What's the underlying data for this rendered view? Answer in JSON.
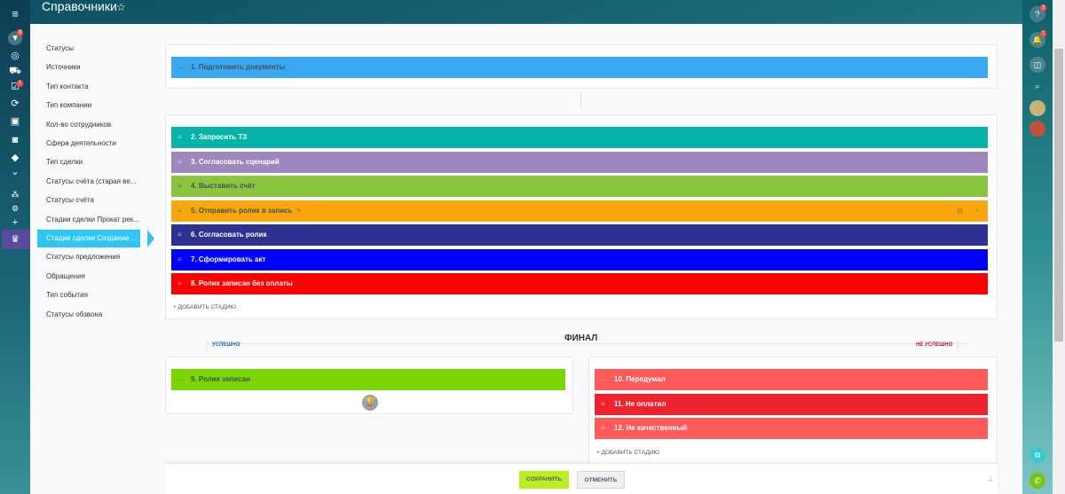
{
  "header": {
    "title": "Справочники"
  },
  "left_nav": [
    {
      "icon": "menu-icon"
    },
    {
      "icon": "filter-icon",
      "badge": "9"
    },
    {
      "icon": "target-icon"
    },
    {
      "icon": "cart-icon"
    },
    {
      "icon": "tasks-icon",
      "badge": "1"
    },
    {
      "icon": "share-icon"
    },
    {
      "icon": "contact-card-icon"
    },
    {
      "icon": "robot-icon"
    },
    {
      "icon": "box-icon"
    },
    {
      "icon": "chevron-down-circle-icon"
    },
    {
      "icon": "sitemap-icon"
    },
    {
      "icon": "gear-icon"
    },
    {
      "icon": "plus-icon"
    },
    {
      "icon": "crown-icon"
    }
  ],
  "menu": [
    "Статусы",
    "Источники",
    "Тип контакта",
    "Тип компании",
    "Кол-во сотрудников",
    "Сфера деятельности",
    "Тип сделки",
    "Статусы счёта (старая ве...",
    "Статусы счёта",
    "Стадии сделки Прокат рек...",
    "Стадии сделки Создание ...",
    "Статусы предложения",
    "Обращения",
    "Тип события",
    "Статусы обзвона"
  ],
  "active_menu_index": 10,
  "first_stage": {
    "label": "1. Подготовить документы",
    "color": "#39a8ef"
  },
  "stages": [
    {
      "label": "2. Запросить ТЗ",
      "color": "#07b2a8",
      "text": "#fff"
    },
    {
      "label": "3. Согласовать сценарий",
      "color": "#9d87bd",
      "text": "#fff"
    },
    {
      "label": "4. Выставить счёт",
      "color": "#8bc43f",
      "text": "#44525e"
    },
    {
      "label": "5. Отправить ролик в запись",
      "color": "#f9a70c",
      "text": "#44525e"
    },
    {
      "label": "6. Согласовать ролик",
      "color": "#2e3192",
      "text": "#fff"
    },
    {
      "label": "7. Сформировать акт",
      "color": "#0000ff",
      "text": "#fff"
    },
    {
      "label": "8. Ролик записан без оплаты",
      "color": "#ff0000",
      "text": "#fff"
    }
  ],
  "add_stage": "+ ДОБАВИТЬ СТАДИЮ",
  "final": {
    "title": "ФИНАЛ",
    "success_label": "УСПЕШНО",
    "fail_label": "НЕ УСПЕШНО",
    "success": {
      "label": "9. Ролик записан",
      "color": "#7bd500"
    },
    "fail": [
      {
        "label": "10. Передумал",
        "color": "#ff5b5b"
      },
      {
        "label": "11. Не оплатил",
        "color": "#ed242d"
      },
      {
        "label": "12. Не качественный",
        "color": "#ff5b5b"
      }
    ]
  },
  "footer": {
    "save": "СОХРАНИТЬ",
    "cancel": "ОТМЕНИТЬ"
  },
  "right_nav": [
    {
      "icon": "help-icon",
      "badge": "2"
    },
    {
      "icon": "bell-icon",
      "badge": "1"
    },
    {
      "icon": "chat-icon"
    },
    {
      "icon": "search-icon"
    },
    {
      "icon": "avatar"
    },
    {
      "icon": "avatar"
    }
  ]
}
